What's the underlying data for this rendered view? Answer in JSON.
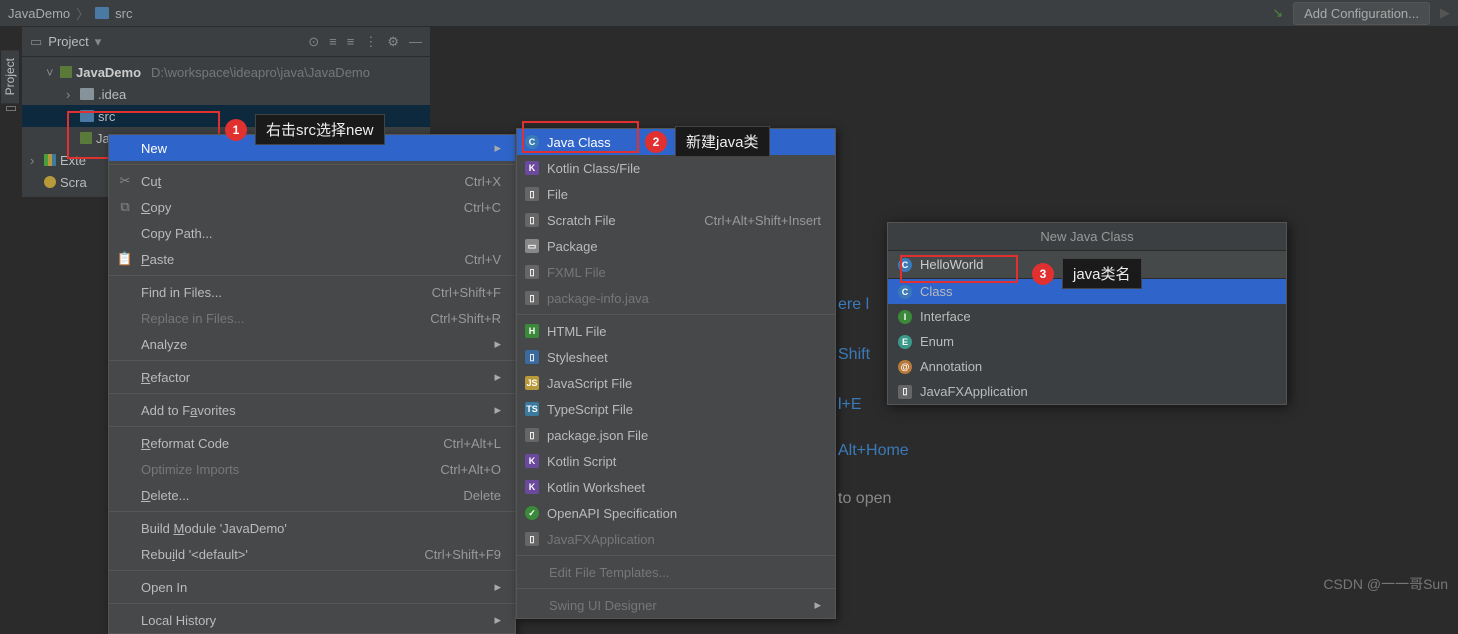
{
  "breadcrumb": {
    "root": "JavaDemo",
    "sub": "src"
  },
  "toolbar": {
    "add_config": "Add Configuration..."
  },
  "sidebar": {
    "label": "Project"
  },
  "panel": {
    "title": "Project"
  },
  "tree": {
    "root": {
      "name": "JavaDemo",
      "path": "D:\\workspace\\ideapro\\java\\JavaDemo"
    },
    "idea": ".idea",
    "src": "src",
    "ja": "Ja",
    "ext": "Exte",
    "scra": "Scra"
  },
  "context_menu": {
    "new": "New",
    "cut": "Cut",
    "cut_sc": "Ctrl+X",
    "copy": "Copy",
    "copy_sc": "Ctrl+C",
    "copy_path": "Copy Path...",
    "paste": "Paste",
    "paste_sc": "Ctrl+V",
    "find_files": "Find in Files...",
    "find_sc": "Ctrl+Shift+F",
    "replace_files": "Replace in Files...",
    "replace_sc": "Ctrl+Shift+R",
    "analyze": "Analyze",
    "refactor": "Refactor",
    "favorites": "Add to Favorites",
    "reformat": "Reformat Code",
    "reformat_sc": "Ctrl+Alt+L",
    "optimize": "Optimize Imports",
    "optimize_sc": "Ctrl+Alt+O",
    "delete": "Delete...",
    "delete_sc": "Delete",
    "build": "Build Module 'JavaDemo'",
    "rebuild": "Rebuild '<default>'",
    "rebuild_sc": "Ctrl+Shift+F9",
    "open_in": "Open In",
    "local_history": "Local History"
  },
  "submenu": {
    "java_class": "Java Class",
    "kotlin": "Kotlin Class/File",
    "file": "File",
    "scratch": "Scratch File",
    "scratch_sc": "Ctrl+Alt+Shift+Insert",
    "package": "Package",
    "fxml": "FXML File",
    "pkginfo": "package-info.java",
    "html": "HTML File",
    "stylesheet": "Stylesheet",
    "js": "JavaScript File",
    "ts": "TypeScript File",
    "pkgjson": "package.json File",
    "kscript": "Kotlin Script",
    "kwork": "Kotlin Worksheet",
    "openapi": "OpenAPI Specification",
    "javafx": "JavaFXApplication",
    "edit_tmpl": "Edit File Templates...",
    "swing": "Swing UI Designer"
  },
  "dialog": {
    "title": "New Java Class",
    "input": "HelloWorld",
    "opts": [
      "Class",
      "Interface",
      "Enum",
      "Annotation",
      "JavaFXApplication"
    ]
  },
  "annotations": {
    "a1": "右击src选择new",
    "a2": "新建java类",
    "a3": "java类名"
  },
  "hints": {
    "h1": "ere l",
    "h2": "Shift",
    "h3": "l+E",
    "h4": "Alt+Home",
    "h5": "to open"
  },
  "watermark": "CSDN @一一哥Sun"
}
